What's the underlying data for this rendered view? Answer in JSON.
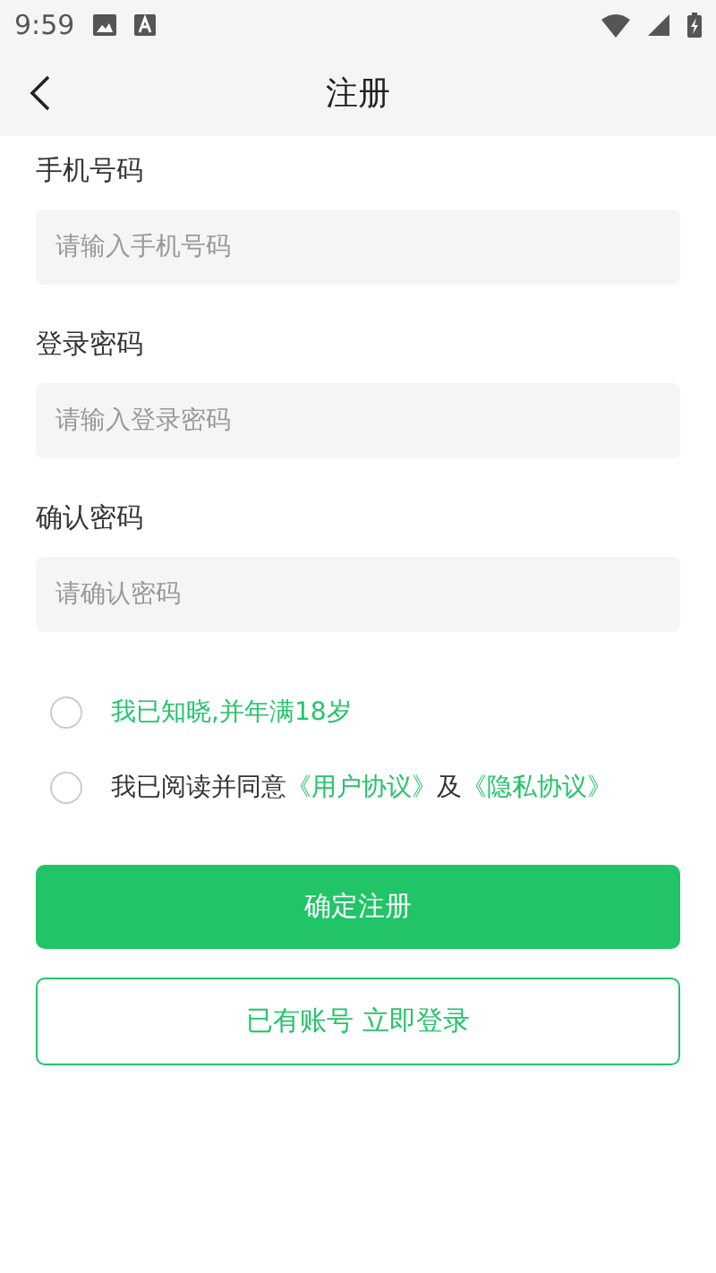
{
  "status_bar": {
    "time": "9:59"
  },
  "header": {
    "title": "注册"
  },
  "fields": [
    {
      "label": "手机号码",
      "placeholder": "请输入手机号码"
    },
    {
      "label": "登录密码",
      "placeholder": "请输入登录密码"
    },
    {
      "label": "确认密码",
      "placeholder": "请确认密码"
    }
  ],
  "agreements": [
    {
      "checked": false,
      "parts": [
        {
          "kind": "link",
          "text": "我已知晓,并年满18岁"
        }
      ]
    },
    {
      "checked": false,
      "parts": [
        {
          "kind": "text",
          "text": "我已阅读并同意"
        },
        {
          "kind": "link",
          "text": "《用户协议》"
        },
        {
          "kind": "text",
          "text": "及"
        },
        {
          "kind": "link",
          "text": "《隐私协议》"
        }
      ]
    }
  ],
  "buttons": [
    {
      "kind": "primary",
      "label": "确定注册"
    },
    {
      "kind": "outline",
      "label": "已有账号 立即登录"
    }
  ]
}
